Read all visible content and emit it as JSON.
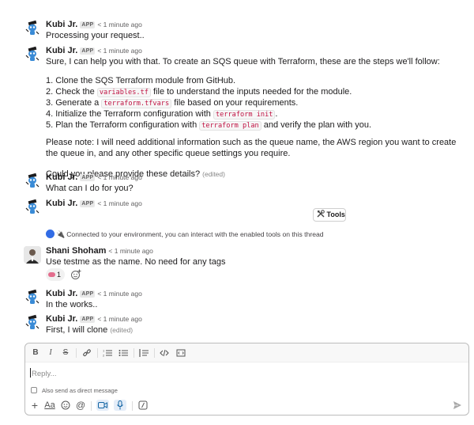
{
  "messages": [
    {
      "author": "Kubi Jr.",
      "badge": "APP",
      "time": "< 1 minute ago",
      "text": "Processing your request.."
    },
    {
      "author": "Kubi Jr.",
      "badge": "APP",
      "time": "< 1 minute ago",
      "intro": "Sure, I can help you with that. To create an SQS queue with Terraform, these are the steps we'll follow:",
      "steps": [
        {
          "number": "1.",
          "before": "Clone the SQS Terraform module from GitHub.",
          "code": "",
          "after": ""
        },
        {
          "number": "2.",
          "before": "Check the ",
          "code": "variables.tf",
          "after": " file to understand the inputs needed for the module."
        },
        {
          "number": "3.",
          "before": "Generate a ",
          "code": "terraform.tfvars",
          "after": " file based on your requirements."
        },
        {
          "number": "4.",
          "before": "Initialize the Terraform configuration with ",
          "code": "terraform init",
          "after": "."
        },
        {
          "number": "5.",
          "before": "Plan the Terraform configuration with ",
          "code": "terraform plan",
          "after": " and verify the plan with you."
        }
      ],
      "note": "Please note: I will need additional information such as the queue name, the AWS region you want to create the queue in, and any other specific queue settings you require.",
      "question": "Could you please provide these details?",
      "edited": "(edited)"
    },
    {
      "author": "Kubi Jr.",
      "badge": "APP",
      "time": "< 1 minute ago",
      "text": "What can I do for you?"
    },
    {
      "author": "Kubi Jr.",
      "badge": "APP",
      "time": "< 1 minute ago",
      "tools_label": "Tools",
      "tools_icon": "tools-icon"
    },
    {
      "status": "Connected to your environment, you can interact with the enabled tools on this thread",
      "status_icons": [
        "kubernetes-icon",
        "plug-icon"
      ]
    },
    {
      "author": "Shani Shoham",
      "time": "< 1 minute ago",
      "text": "Use testme as the name. No need for any tags",
      "reaction_count": "1"
    },
    {
      "author": "Kubi Jr.",
      "badge": "APP",
      "time": "< 1 minute ago",
      "text": "In the works.."
    },
    {
      "author": "Kubi Jr.",
      "badge": "APP",
      "time": "< 1 minute ago",
      "text": "First, I will clone",
      "edited": "(edited)"
    }
  ],
  "composer": {
    "placeholder": "Reply...",
    "also_send": "Also send as direct message",
    "format_icons": [
      "bold-icon",
      "italic-icon",
      "strikethrough-icon",
      "link-icon",
      "ordered-list-icon",
      "bulleted-list-icon",
      "blockquote-icon",
      "code-icon",
      "code-block-icon"
    ],
    "bottom_icons": [
      "plus-icon",
      "text-format-icon",
      "emoji-icon",
      "mention-icon",
      "video-icon",
      "microphone-icon",
      "slash-command-icon",
      "send-icon"
    ],
    "text_format_label": "Aa"
  },
  "colors": {
    "link": "#1264a3",
    "code": "#c01343",
    "kubernetes": "#326ce5",
    "bot_blue": "#3a8bd6"
  }
}
